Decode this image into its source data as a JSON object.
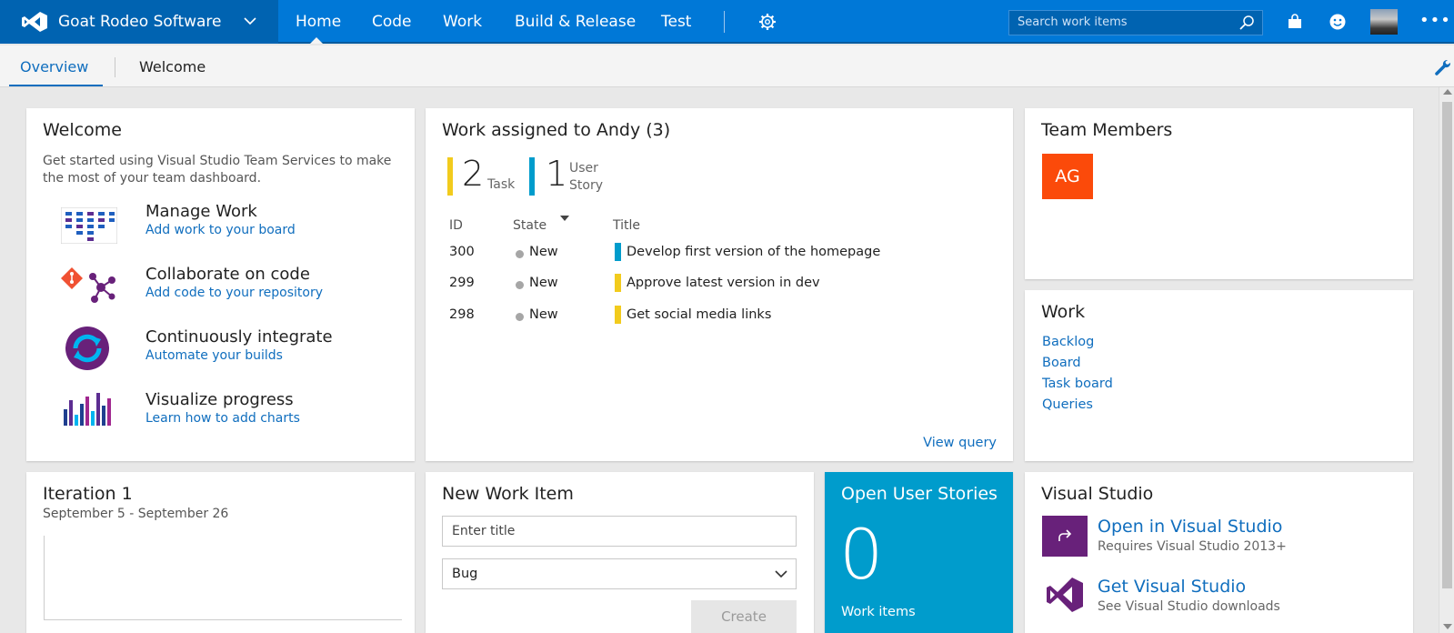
{
  "header": {
    "org_name": "Goat Rodeo Software",
    "nav": [
      "Home",
      "Code",
      "Work",
      "Build & Release",
      "Test"
    ],
    "search_placeholder": "Search work items",
    "more": "•••",
    "accent": "#0078d7"
  },
  "subnav": {
    "tabs": [
      "Overview",
      "Welcome"
    ]
  },
  "welcome": {
    "title": "Welcome",
    "intro": "Get started using Visual Studio Team Services to make the most of your team dashboard.",
    "items": [
      {
        "heading": "Manage Work",
        "link": "Add work to your board",
        "icon": "board-icon"
      },
      {
        "heading": "Collaborate on code",
        "link": "Add code to your repository",
        "icon": "git-icon"
      },
      {
        "heading": "Continuously integrate",
        "link": "Automate your builds",
        "icon": "build-cycle-icon"
      },
      {
        "heading": "Visualize progress",
        "link": "Learn how to add charts",
        "icon": "chart-icon"
      }
    ]
  },
  "assigned": {
    "title": "Work assigned to Andy (3)",
    "counts": [
      {
        "value": "2",
        "label": "Task",
        "color": "#f2cb1d"
      },
      {
        "value": "1",
        "label_line1": "User",
        "label_line2": "Story",
        "color": "#009ccc"
      }
    ],
    "columns": [
      "ID",
      "State",
      "Title"
    ],
    "rows": [
      {
        "id": "300",
        "state": "New",
        "title": "Develop first version of the homepage",
        "color": "#009ccc"
      },
      {
        "id": "299",
        "state": "New",
        "title": "Approve latest version in dev",
        "color": "#f2cb1d"
      },
      {
        "id": "298",
        "state": "New",
        "title": "Get social media links",
        "color": "#f2cb1d"
      }
    ],
    "view_query": "View query"
  },
  "team": {
    "title": "Team Members",
    "member_initials": "AG",
    "member_color": "#fb4a0a"
  },
  "work": {
    "title": "Work",
    "links": [
      "Backlog",
      "Board",
      "Task board",
      "Queries"
    ]
  },
  "iteration": {
    "title": "Iteration 1",
    "dates": "September 5 - September 26"
  },
  "new_work_item": {
    "title": "New Work Item",
    "title_placeholder": "Enter title",
    "type_value": "Bug",
    "create_label": "Create"
  },
  "open_stories": {
    "title": "Open User Stories",
    "count": "0",
    "caption": "Work items",
    "color": "#009ccc"
  },
  "visual_studio": {
    "title": "Visual Studio",
    "items": [
      {
        "heading": "Open in Visual Studio",
        "sub": "Requires Visual Studio 2013+"
      },
      {
        "heading": "Get Visual Studio",
        "sub": "See Visual Studio downloads"
      }
    ]
  }
}
